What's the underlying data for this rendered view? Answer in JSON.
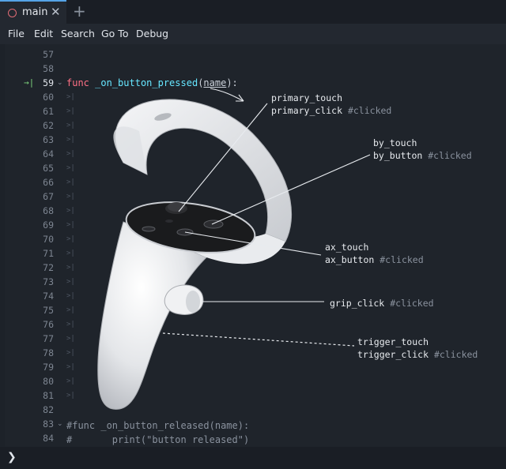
{
  "tab": {
    "label": "main",
    "close": "✕",
    "add": "+"
  },
  "menu": [
    "File",
    "Edit",
    "Search",
    "Go To",
    "Debug"
  ],
  "lines": [
    "57",
    "58",
    "59",
    "60",
    "61",
    "62",
    "63",
    "64",
    "65",
    "66",
    "67",
    "68",
    "69",
    "70",
    "71",
    "72",
    "73",
    "74",
    "75",
    "76",
    "77",
    "78",
    "79",
    "80",
    "81",
    "82",
    "83",
    "84"
  ],
  "exec_marker": "→|",
  "code": {
    "l59": {
      "kw": "func",
      "name": "_on_button_pressed",
      "open": "(",
      "param": "name",
      "close": "):"
    },
    "l83": "#func _on_button_released(name):",
    "l84": "#\tprint(\"button released\")"
  },
  "callouts": {
    "primary": {
      "a": "primary_touch",
      "b": "primary_click",
      "tag": "#clicked"
    },
    "by": {
      "a": "by_touch",
      "b": "by_button",
      "tag": "#clicked"
    },
    "ax": {
      "a": "ax_touch",
      "b": "ax_button",
      "tag": "#clicked"
    },
    "grip": {
      "a": "grip_click",
      "tag": "#clicked"
    },
    "trigger": {
      "a": "trigger_touch",
      "b": "trigger_click",
      "tag": "#clicked"
    }
  },
  "status": {
    "prompt": "❯"
  },
  "colors": {
    "accent": "#55a3e6",
    "keyword": "#ff7085",
    "function": "#66e6ff",
    "comment": "#8a929e",
    "exec": "#7ed57e"
  }
}
